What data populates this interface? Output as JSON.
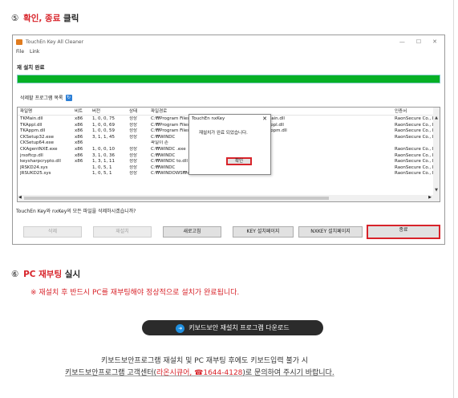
{
  "step5": {
    "num": "⑤",
    "title_a": "확인, 종료",
    "title_b": "클릭"
  },
  "window": {
    "title": "TouchEn Key All Cleaner",
    "menu": [
      "File",
      "Link"
    ],
    "status_label": "재 설치 완료",
    "progress_fraction": 1.0,
    "progress_color": "#06b025",
    "list_label": "삭제할 프로그램 목록",
    "columns": [
      "파일명",
      "비트",
      "버전",
      "상태",
      "파일경로",
      "인증서"
    ],
    "rows": [
      [
        "TKMain.dll",
        "x86",
        "1, 0, 0, 75",
        "정상",
        "C:₩Program Files₩RaonSecure₩TouchEn nxKey₩TKMain.dll",
        "RaonSecure Co., Ltd"
      ],
      [
        "TKAppl.dll",
        "x86",
        "1, 0, 0, 69",
        "정상",
        "C:₩Program Files₩RaonSecure₩TouchEn nxKey₩TKAppl.dll",
        "RaonSecure Co., Ltd"
      ],
      [
        "TKAppm.dll",
        "x86",
        "1, 0, 0, 59",
        "정상",
        "C:₩Program Files₩RaonSecure₩TouchEn nxKey₩TKAppm.dll",
        "RaonSecure Co., Ltd"
      ],
      [
        "CKSetup32.exe",
        "x86",
        "3, 1, 1, 45",
        "정상",
        "C:₩WINDC",
        "RaonSecure Co., Ltd"
      ],
      [
        "CKSetup64.exe",
        "x86",
        "",
        "",
        "파일이 존",
        ""
      ],
      [
        "CKAgentNXE.exe",
        "x86",
        "1, 0, 0, 10",
        "정상",
        "C:₩WINDC                       .exe",
        "RaonSecure Co., Ltd"
      ],
      [
        "jrsoftcp.dll",
        "x86",
        "3, 1, 0, 36",
        "정상",
        "C:₩WINDC",
        "RaonSecure Co., Ltd"
      ],
      [
        "keysharpcrypto.dll",
        "x86",
        "1, 3, 1, 11",
        "정상",
        "C:₩WINDC                            to.dll",
        "RaonSecure Co., Ltd"
      ],
      [
        "JRSKD24.sys",
        "",
        "1, 0, 5, 1",
        "정상",
        "C:₩WINDC",
        "RaonSecure Co., Ltd"
      ],
      [
        "JRSUKD25.sys",
        "",
        "1, 0, 5, 1",
        "정상",
        "C:₩WINDOWS₩system32₩JRSUKD25.sys",
        "RaonSecure Co., Ltd"
      ]
    ],
    "question": "TouchEn Key와 nxKey의 모든 파일을 삭제하시겠습니까?",
    "buttons": {
      "delete": "삭제",
      "reinstall": "재설치",
      "refresh": "새로고침",
      "key_install": "KEY 설치페이지",
      "nxkey_install": "NXKEY 설치페이지",
      "close": "종료"
    }
  },
  "msgbox": {
    "title": "TouchEn nxKey",
    "message": "재설치가 완료 되었습니다.",
    "ok": "확인"
  },
  "step6": {
    "num": "⑥",
    "title_a": "PC 재부팅",
    "title_b": "실시"
  },
  "notice": "※ 재설치 후 반드시 PC를 재부팅해야 정상적으로 설치가 완료됩니다.",
  "download_button": "키보드보안 재설치 프로그램 다운로드",
  "help_line1": "키보드보안프로그램 재설치 및 PC 재부팅 후에도 키보드입력 불가 시",
  "help_line2_pre": "키보드보안프로그램 고객센터(",
  "help_line2_link": "라온시큐어, ☎1644-4128",
  "help_line2_post": ")로 문의하여 주시기 바랍니다.",
  "colors": {
    "accent_red": "#d8232a",
    "progress_green": "#06b025",
    "download_bg": "#2b2b2b"
  }
}
